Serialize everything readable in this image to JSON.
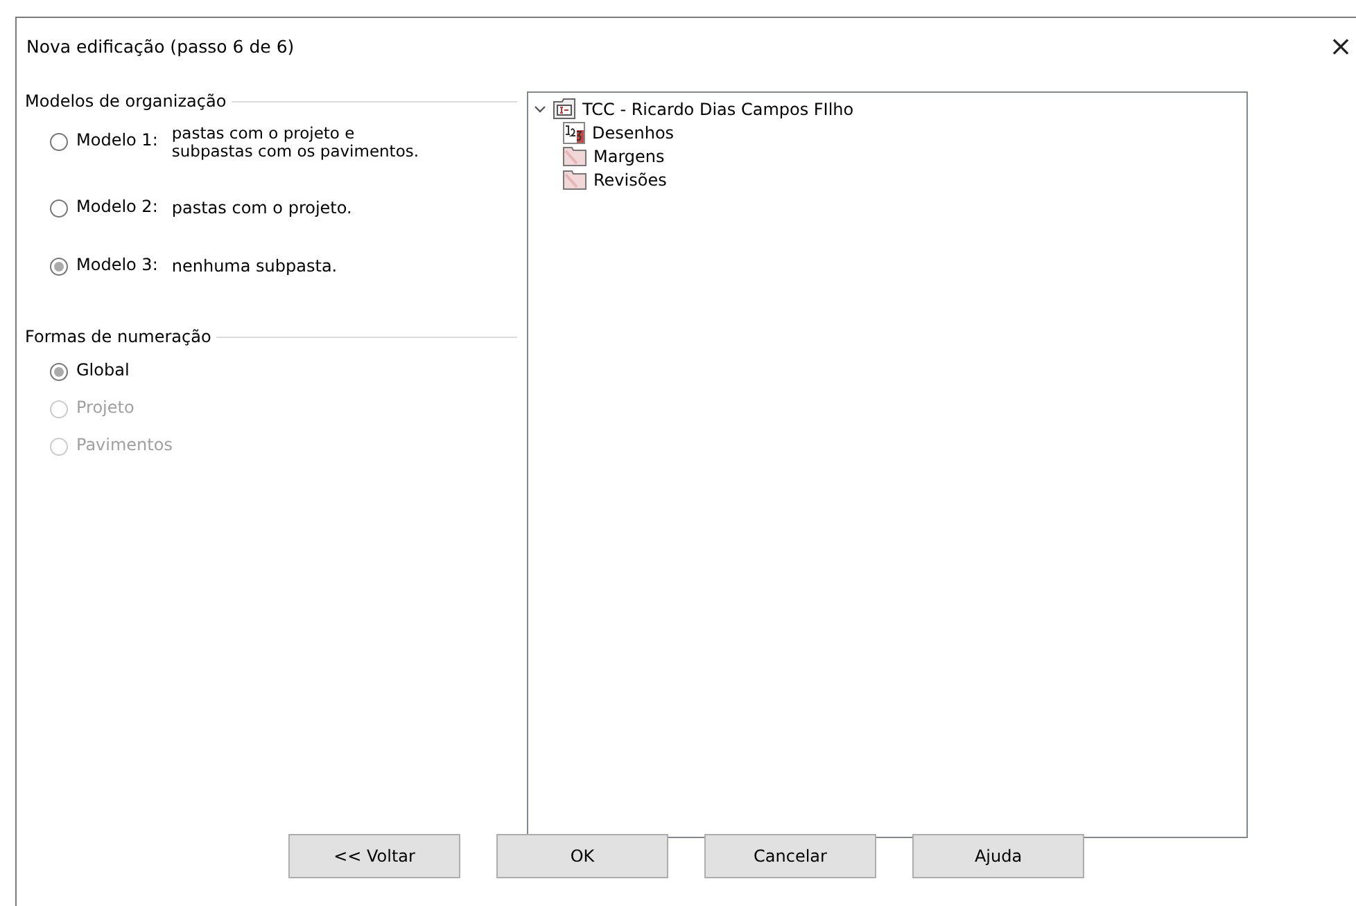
{
  "window": {
    "title": "Nova edificação (passo 6 de 6)",
    "close": "×"
  },
  "organization": {
    "title": "Modelos de organização",
    "options": [
      {
        "label": "Modelo 1:",
        "description": "pastas com o projeto e subpastas com os pavimentos.",
        "selected": false
      },
      {
        "label": "Modelo 2:",
        "description": "pastas com o projeto.",
        "selected": false
      },
      {
        "label": "Modelo 3:",
        "description": "nenhuma subpasta.",
        "selected": true
      }
    ]
  },
  "numbering": {
    "title": "Formas de numeração",
    "options": [
      {
        "label": "Global",
        "selected": true,
        "disabled": false
      },
      {
        "label": "Projeto",
        "selected": false,
        "disabled": true
      },
      {
        "label": "Pavimentos",
        "selected": false,
        "disabled": true
      }
    ]
  },
  "tree": {
    "label": "TCC - Ricardo Dias Campos FIlho",
    "expanded": true,
    "children": [
      {
        "label": "Desenhos",
        "kind": "numbers"
      },
      {
        "label": "Margens",
        "kind": "folder"
      },
      {
        "label": "Revisões",
        "kind": "folder"
      }
    ]
  },
  "buttons": [
    "<< Voltar",
    "OK",
    "Cancelar",
    "Ajuda"
  ]
}
